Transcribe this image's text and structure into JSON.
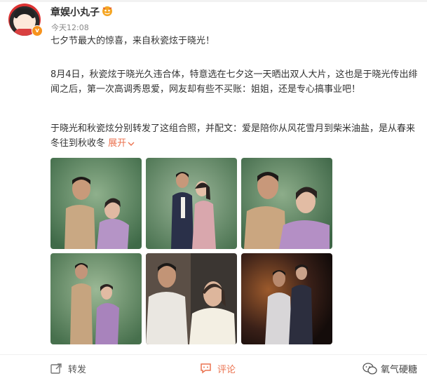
{
  "post": {
    "username": "章娱小丸子",
    "timestamp": "今天12:08",
    "paragraph1": "七夕节最大的惊喜，来自秋瓷炫于晓光！",
    "paragraph2": "8月4日，秋瓷炫于晓光久违合体，特意选在七夕这一天晒出双人大片，这也是于晓光传出绯闻之后，第一次高调秀恩爱，网友却有些不买账：姐姐，还是专心搞事业吧！",
    "paragraph3": "于晓光和秋瓷炫分别转发了这组合照，并配文：爱是陪你从风花雪月到柴米油盐，是从春来冬往到秋收冬",
    "expand_label": "展开",
    "photo_count": 6
  },
  "actions": {
    "forward_label": "转发",
    "comment_label": "评论"
  },
  "watermark": {
    "text": "氧气硬糖"
  },
  "colors": {
    "accent": "#eb7350",
    "verified_badge": "#f7931e"
  },
  "icons": [
    "verified-v-icon",
    "user-level-badge-icon",
    "chevron-down-icon",
    "forward-icon",
    "comment-icon",
    "wechat-icon"
  ]
}
